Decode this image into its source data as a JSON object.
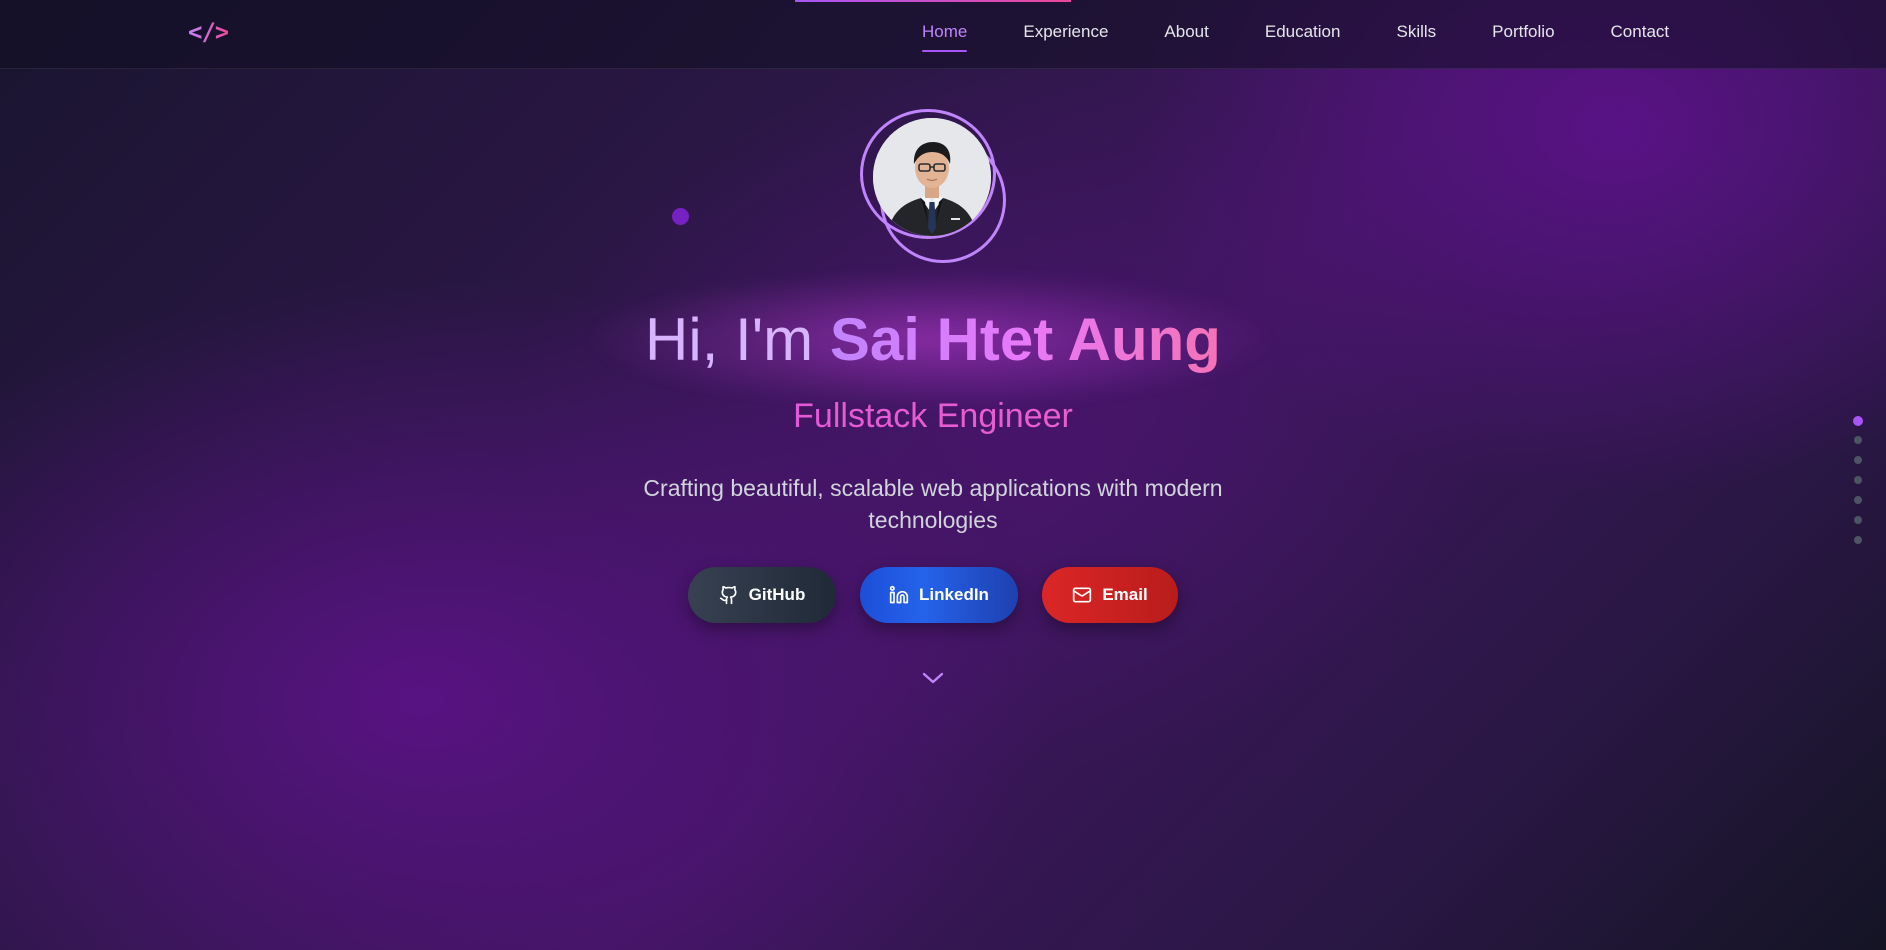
{
  "header": {
    "logo": "</>",
    "nav": [
      {
        "label": "Home",
        "active": true
      },
      {
        "label": "Experience",
        "active": false
      },
      {
        "label": "About",
        "active": false
      },
      {
        "label": "Education",
        "active": false
      },
      {
        "label": "Skills",
        "active": false
      },
      {
        "label": "Portfolio",
        "active": false
      },
      {
        "label": "Contact",
        "active": false
      }
    ],
    "scroll_progress": 0.0
  },
  "hero": {
    "avatar_icon": "profile-photo",
    "greeting": "Hi, I'm ",
    "name": "Sai Htet Aung",
    "role": "Fullstack Engineer",
    "tagline": "Crafting beautiful, scalable web applications with modern technologies",
    "buttons": [
      {
        "label": "GitHub",
        "icon": "github-icon",
        "color": "#374151"
      },
      {
        "label": "LinkedIn",
        "icon": "linkedin-icon",
        "color": "#1d4ed8"
      },
      {
        "label": "Email",
        "icon": "mail-icon",
        "color": "#dc2626"
      }
    ],
    "scroll_icon": "chevron-down-icon"
  },
  "side_nav": {
    "count": 7,
    "active_index": 0
  },
  "colors": {
    "accent": "#a855f7",
    "accent_pink": "#ec4899",
    "background": "#2d1748"
  }
}
